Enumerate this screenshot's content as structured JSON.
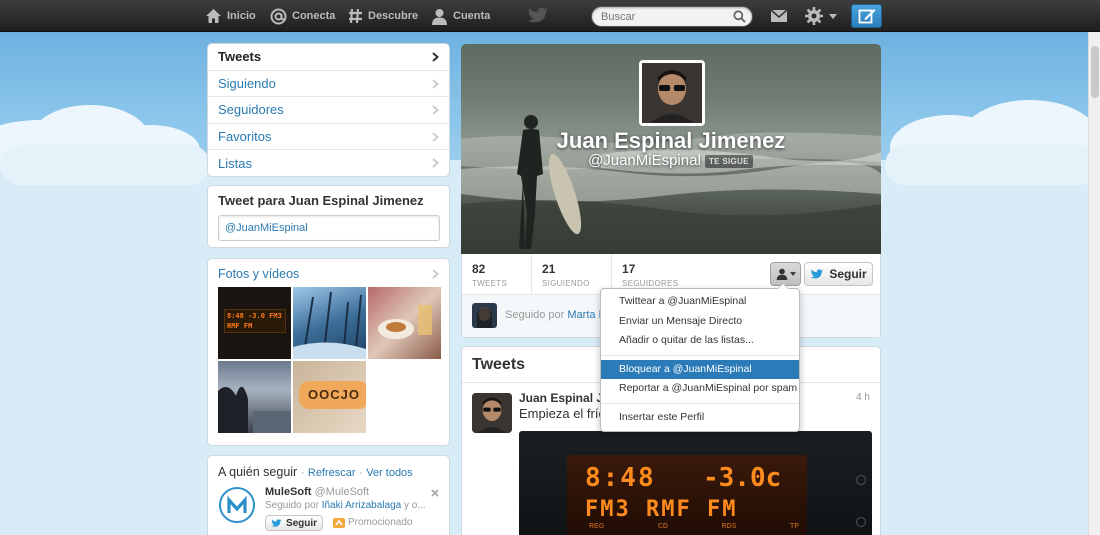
{
  "topbar": {
    "nav": [
      {
        "label": "Inicio",
        "icon": "home-icon"
      },
      {
        "label": "Conecta",
        "icon": "at-icon"
      },
      {
        "label": "Descubre",
        "icon": "hash-icon"
      },
      {
        "label": "Cuenta",
        "icon": "person-icon"
      }
    ],
    "search_placeholder": "Buscar"
  },
  "sidebar": {
    "items": [
      {
        "label": "Tweets"
      },
      {
        "label": "Siguiendo"
      },
      {
        "label": "Seguidores"
      },
      {
        "label": "Favoritos"
      },
      {
        "label": "Listas"
      }
    ]
  },
  "tweet_to": {
    "title": "Tweet para Juan Espinal Jimenez",
    "input_value": "@JuanMiEspinal"
  },
  "media": {
    "title": "Fotos y vídeos",
    "photo_text": "8:48 -3.0 FM3 RMF FM",
    "photo_text_2": "OOCJO"
  },
  "who_to_follow": {
    "title": "A quién seguir",
    "sep1": "·",
    "refresh": "Refrescar",
    "sep2": "·",
    "view_all": "Ver todos",
    "suggestion": {
      "name": "MuleSoft",
      "handle": "@MuleSoft",
      "followed_by_prefix": "Seguido por",
      "followed_by_name": "Iñaki Arrizabalaga",
      "followed_by_suffix": "y o...",
      "follow_label": "Seguir",
      "promoted": "Promocionado"
    }
  },
  "profile": {
    "name": "Juan Espinal Jimenez",
    "handle": "@JuanMiEspinal",
    "follows_you": "TE SIGUE",
    "stats": [
      {
        "value": "82",
        "label": "TWEETS"
      },
      {
        "value": "21",
        "label": "SIGUIENDO"
      },
      {
        "value": "17",
        "label": "SEGUIDORES"
      }
    ],
    "follow_label": "Seguir",
    "followed_by_prefix": "Seguido por",
    "followed_by_name": "Marta E"
  },
  "user_menu": {
    "items": [
      "Twittear a @JuanMiEspinal",
      "Enviar un Mensaje Directo",
      "Añadir o quitar de las listas..."
    ],
    "highlighted": [
      "Bloquear a @JuanMiEspinal",
      "Reportar a @JuanMiEspinal por spam"
    ],
    "embed": "Insertar este Perfil"
  },
  "tweets": {
    "title": "Tweets",
    "tweet": {
      "author": "Juan Espinal Ji",
      "time": "4 h",
      "text": "Empieza el frío!!",
      "photo_time": "8:48",
      "photo_temp": "-3.0c",
      "photo_station": "FM3 RMF FM",
      "photo_small_labels": [
        "REG",
        "CD",
        "RDS",
        "TP"
      ]
    }
  },
  "colors": {
    "link": "#2a7ab0",
    "highlight": "#2b7bb9",
    "topbar": "#2b2b2b"
  }
}
